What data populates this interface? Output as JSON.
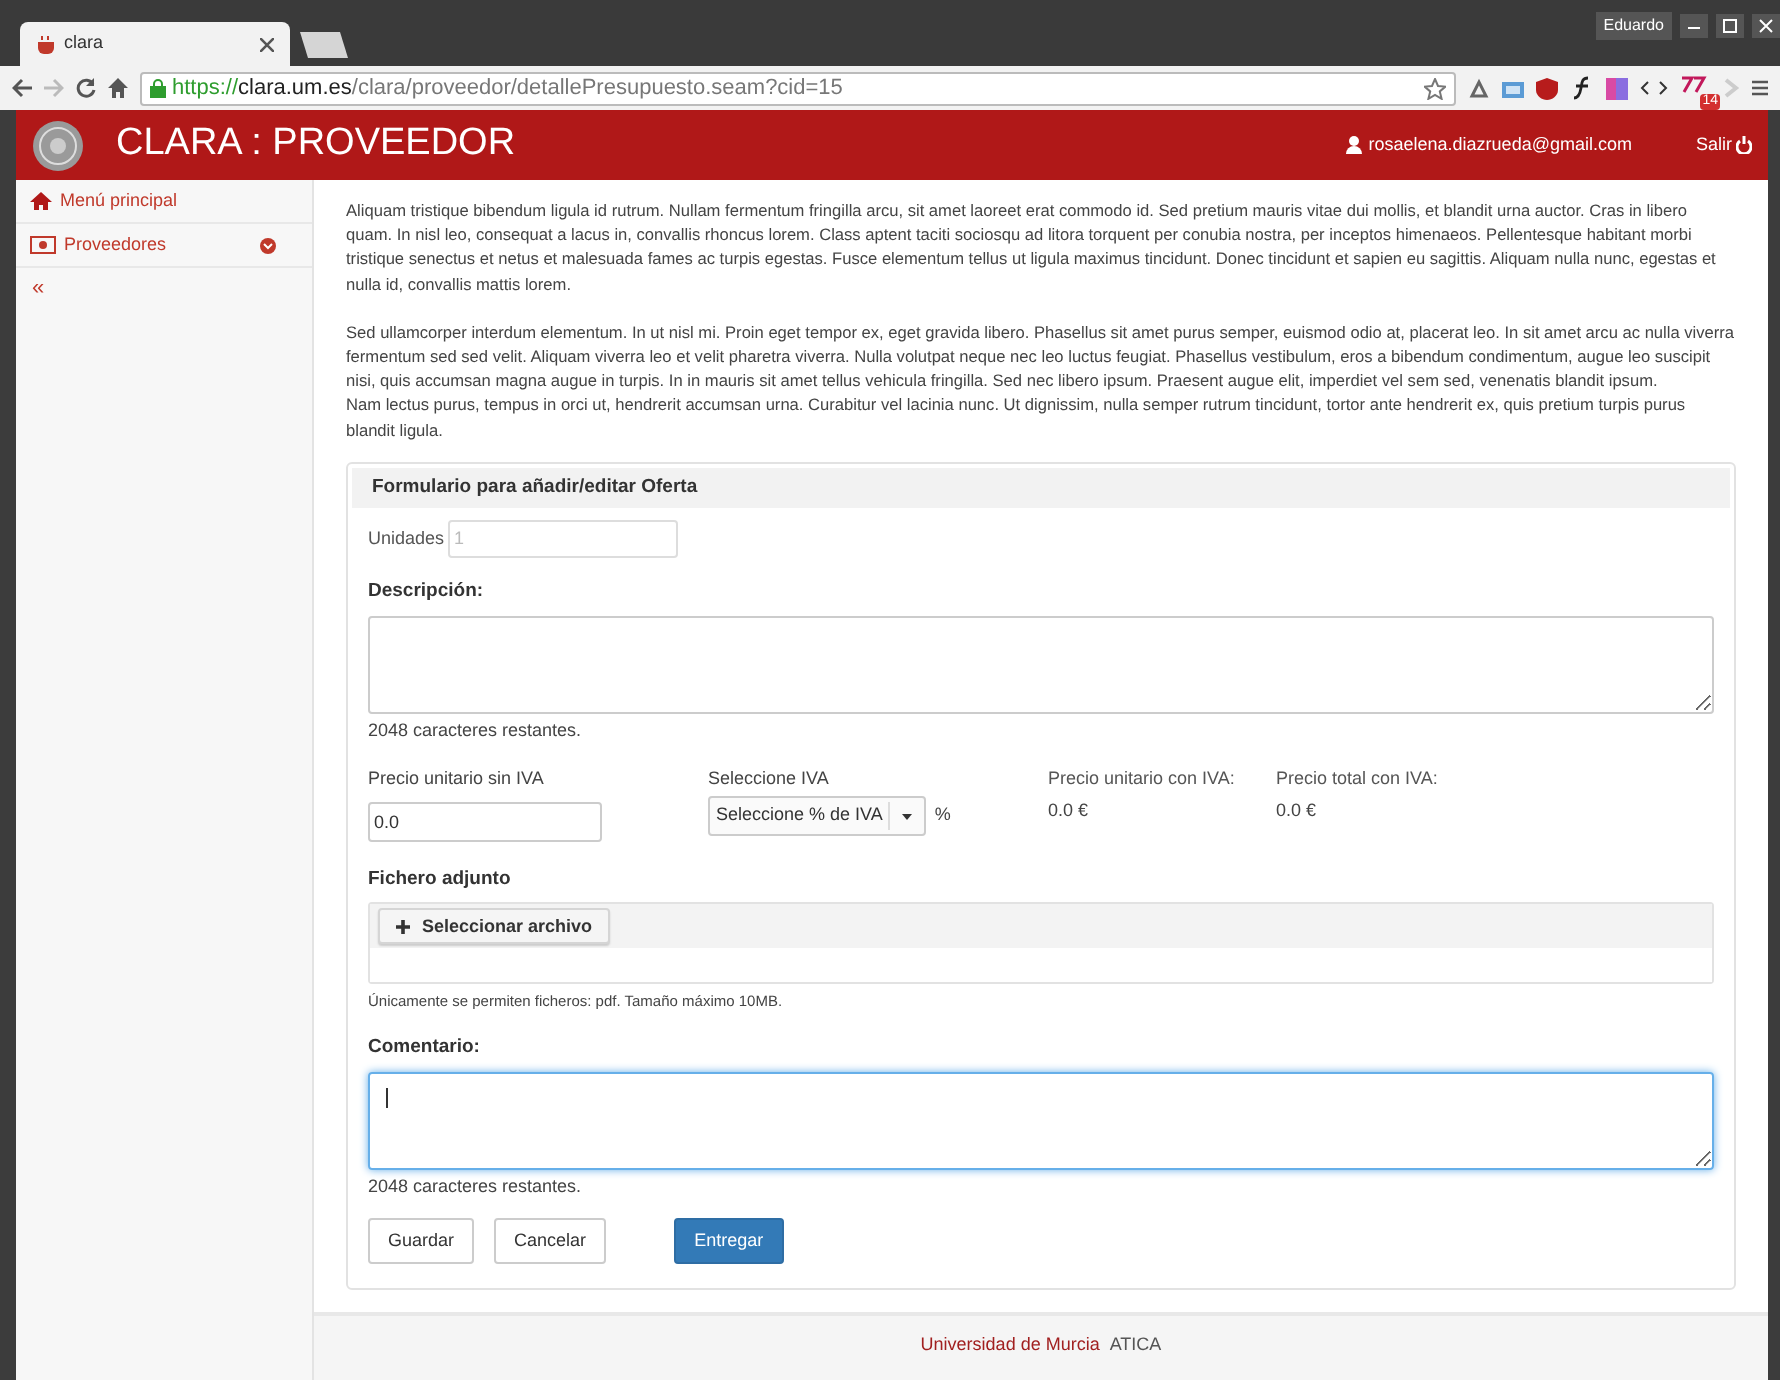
{
  "window": {
    "user": "Eduardo"
  },
  "browser": {
    "tabs": [
      {
        "title": "clara",
        "selected": true
      }
    ],
    "url": {
      "scheme": "https://",
      "host": "clara.um.es",
      "path": "/clara/proveedor/detallePresupuesto.seam?cid=15"
    },
    "extension_badge": "14"
  },
  "header": {
    "title": "CLARA : PROVEEDOR",
    "user_email": "rosaelena.diazrueda@gmail.com",
    "logout": "Salir"
  },
  "sidebar": {
    "items": [
      {
        "label": "Menú principal",
        "kind": "home"
      },
      {
        "label": "Proveedores",
        "kind": "money",
        "expanded": false
      }
    ],
    "collapse": "«"
  },
  "intro": [
    [
      "Aliquam tristique bibendum ligula id rutrum. Nullam fermentum fringilla arcu, sit amet laoreet erat commodo id. Sed pretium mauris vitae dui mollis, et blandit urna auctor. Cras in libero quam. In nisl leo, consequat a lacus in, convallis rhoncus lorem. Class aptent taciti sociosqu ad litora torquent per conubia nostra, per inceptos himenaeos. Pellentesque habitant morbi tristique senectus et netus et malesuada fames ac turpis egestas. Fusce elementum tellus ut ligula maximus tincidunt. Donec tincidunt et sapien eu sagittis. Aliquam nulla nunc, egestas et nulla id, convallis mattis lorem."
    ],
    [
      "Sed ullamcorper interdum elementum. In ut nisl mi. Proin eget tempor ex, eget gravida libero. Phasellus sit amet purus semper, euismod odio at, placerat leo. In sit amet arcu ac nulla viverra fermentum sed sed velit. Aliquam viverra leo et velit pharetra viverra. Nulla volutpat neque nec leo luctus feugiat. Phasellus vestibulum, eros a bibendum condimentum, augue leo suscipit nisi, quis accumsan magna augue in turpis. In in mauris sit amet tellus vehicula fringilla. Sed nec libero ipsum. Praesent augue elit, imperdiet vel sem sed, venenatis blandit ipsum.",
      "Nam lectus purus, tempus in orci ut, hendrerit accumsan urna. Curabitur vel lacinia nunc. Ut dignissim, nulla semper rutrum tincidunt, tortor ante hendrerit ex, quis pretium turpis purus blandit ligula."
    ]
  ],
  "form": {
    "title": "Formulario para añadir/editar Oferta",
    "units": {
      "label": "Unidades",
      "placeholder": "1"
    },
    "description": {
      "label": "Descripción:",
      "counter": "2048 caracteres restantes.",
      "focused": false
    },
    "unit_price": {
      "label": "Precio unitario sin IVA",
      "value": "0.0"
    },
    "vat": {
      "label": "Seleccione IVA",
      "value": "Seleccione % de IVA",
      "suffix": "%"
    },
    "unit_price_vat": {
      "label": "Precio unitario con IVA:",
      "value": "0.0 €"
    },
    "total_price_vat": {
      "label": "Precio total con IVA:",
      "value": "0.0 €"
    },
    "attachment": {
      "label": "Fichero adjunto",
      "button": "Seleccionar archivo",
      "hint": "Únicamente se permiten ficheros: pdf. Tamaño máximo 10MB."
    },
    "comment": {
      "label": "Comentario:",
      "counter": "2048 caracteres restantes.",
      "focused": true
    },
    "buttons": [
      {
        "label": "Guardar",
        "kind": "default"
      },
      {
        "label": "Cancelar",
        "kind": "default"
      },
      {
        "label": "Entregar",
        "kind": "primary"
      }
    ]
  },
  "footer": {
    "org": "Universidad de Murcia",
    "unit": "ATICA"
  }
}
